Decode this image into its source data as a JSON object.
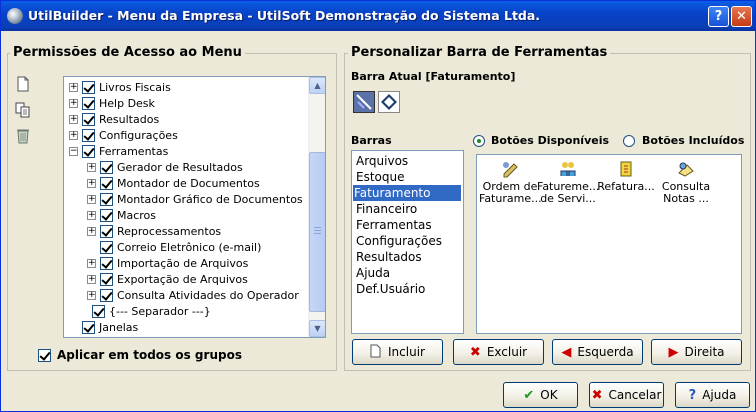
{
  "window": {
    "title": "UtilBuilder - Menu da Empresa - UtilSoft Demonstração do Sistema Ltda.",
    "help_glyph": "?",
    "close_glyph": "✕"
  },
  "left_panel": {
    "title": "Permissões de Acesso ao Menu",
    "tree": [
      {
        "label": "Livros Fiscais",
        "level": 0,
        "expander": "+",
        "checked": true
      },
      {
        "label": "Help Desk",
        "level": 0,
        "expander": "+",
        "checked": true
      },
      {
        "label": "Resultados",
        "level": 0,
        "expander": "+",
        "checked": true
      },
      {
        "label": "Configurações",
        "level": 0,
        "expander": "+",
        "checked": true
      },
      {
        "label": "Ferramentas",
        "level": 0,
        "expander": "−",
        "checked": true
      },
      {
        "label": "Gerador de Resultados",
        "level": 1,
        "expander": "+",
        "checked": true
      },
      {
        "label": "Montador de Documentos",
        "level": 1,
        "expander": "+",
        "checked": true
      },
      {
        "label": "Montador Gráfico de Documentos",
        "level": 1,
        "expander": "+",
        "checked": true
      },
      {
        "label": "Macros",
        "level": 1,
        "expander": "+",
        "checked": true
      },
      {
        "label": "Reprocessamentos",
        "level": 1,
        "expander": "+",
        "checked": true
      },
      {
        "label": "Correio Eletrônico (e-mail)",
        "level": 1,
        "expander": "",
        "checked": true
      },
      {
        "label": "Importação de Arquivos",
        "level": 1,
        "expander": "+",
        "checked": true
      },
      {
        "label": "Exportação de Arquivos",
        "level": 1,
        "expander": "+",
        "checked": true
      },
      {
        "label": "Consulta Atividades do Operador",
        "level": 1,
        "expander": "+",
        "checked": true
      },
      {
        "label": "{--- Separador ---}",
        "level": 2,
        "expander": "",
        "checked": true
      },
      {
        "label": "Janelas",
        "level": 0,
        "expander": "",
        "checked": true
      }
    ],
    "apply_all": {
      "label": "Aplicar em todos os grupos",
      "checked": true
    }
  },
  "right_panel": {
    "title": "Personalizar Barra de Ferramentas",
    "current_bar_label": "Barra Atual [Faturamento]",
    "bars_label": "Barras",
    "bars": [
      "Arquivos",
      "Estoque",
      "Faturamento",
      "Financeiro",
      "Ferramentas",
      "Configurações",
      "Resultados",
      "Ajuda",
      "Def.Usuário"
    ],
    "selected_bar": "Faturamento",
    "radio_available": "Botões Disponíveis",
    "radio_included": "Botões Incluídos",
    "selected_radio": "available",
    "buttons": [
      {
        "line1": "Ordem de",
        "line2": "Faturame...",
        "icon": "order-icon"
      },
      {
        "line1": "Fatureme...",
        "line2": "de Servi...",
        "icon": "service-billing-icon"
      },
      {
        "line1": "Refatura...",
        "line2": "",
        "icon": "rebilling-icon"
      },
      {
        "line1": "Consulta",
        "line2": "Notas ...",
        "icon": "query-notes-icon"
      }
    ],
    "actions": {
      "include": "Incluir",
      "delete": "Excluir",
      "left": "Esquerda",
      "right": "Direita"
    }
  },
  "footer": {
    "ok": "OK",
    "cancel": "Cancelar",
    "help": "Ajuda"
  },
  "colors": {
    "accent": "#316ac5",
    "title_bar": "#0842c8",
    "check": "#21a121"
  }
}
